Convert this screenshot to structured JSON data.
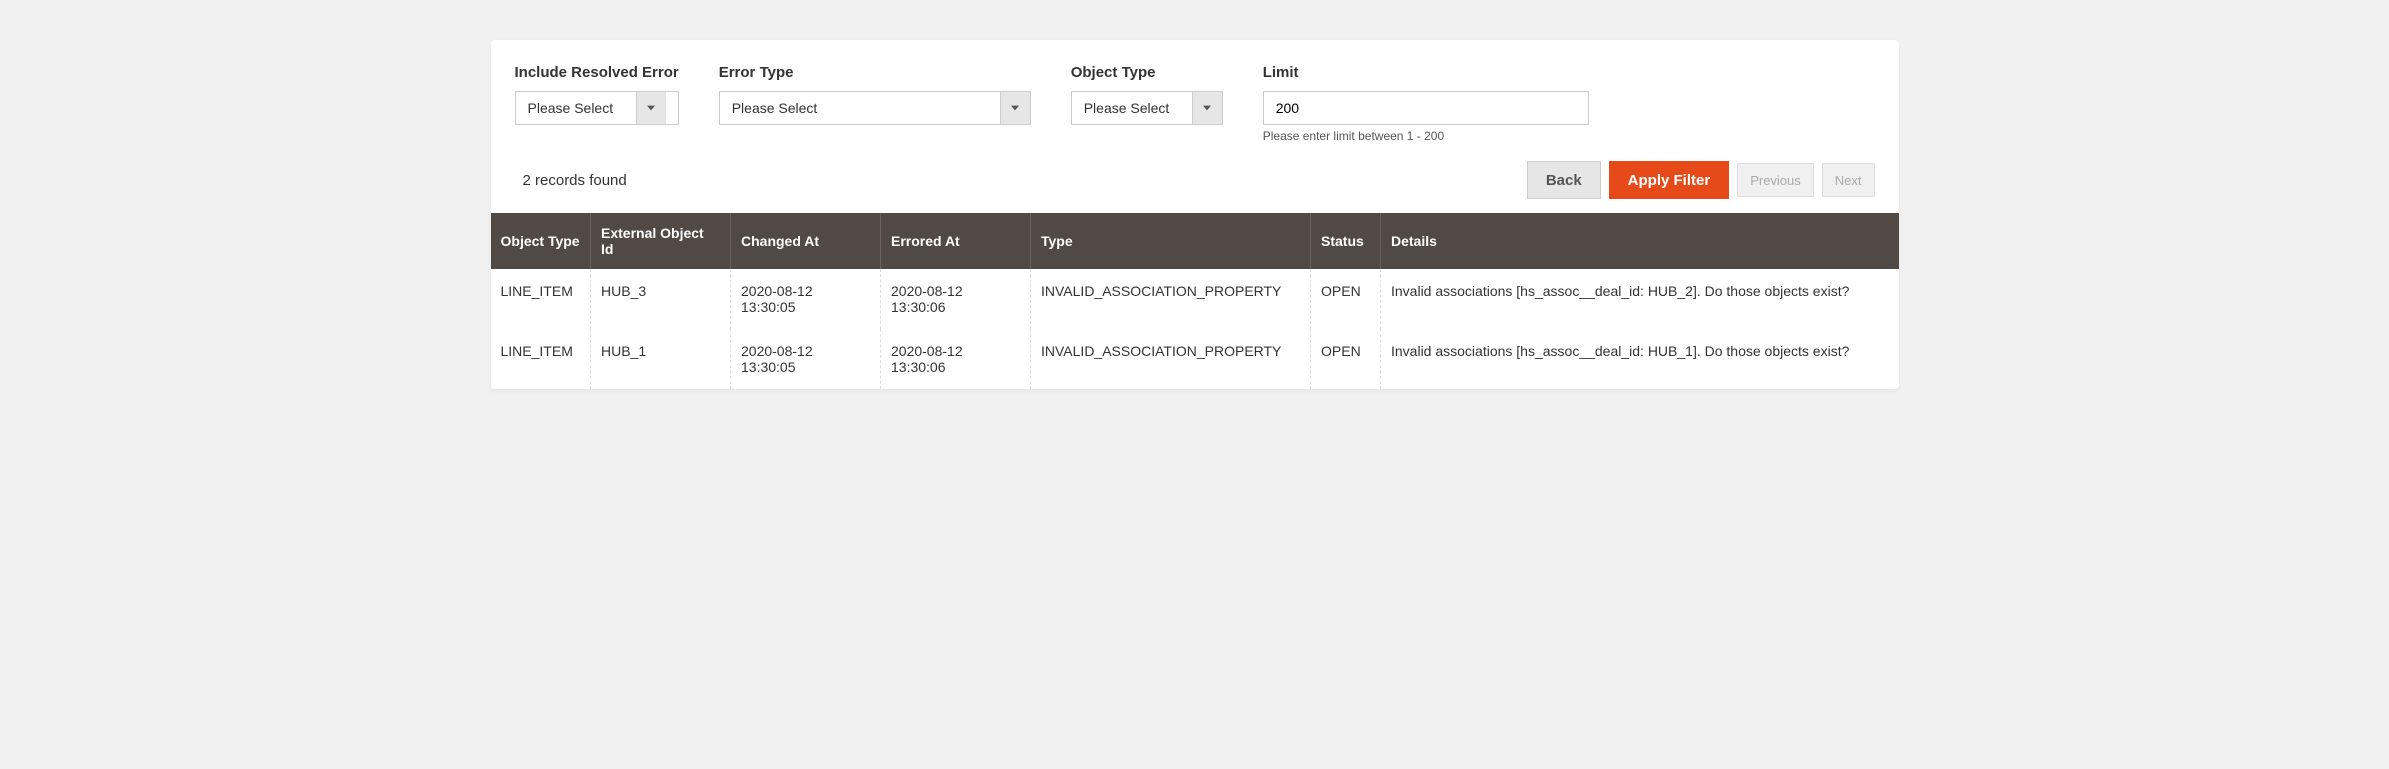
{
  "filters": {
    "include_resolved": {
      "label": "Include Resolved Error",
      "placeholder": "Please Select"
    },
    "error_type": {
      "label": "Error Type",
      "placeholder": "Please Select"
    },
    "object_type": {
      "label": "Object Type",
      "placeholder": "Please Select"
    },
    "limit": {
      "label": "Limit",
      "value": "200",
      "hint": "Please enter limit between 1 - 200"
    }
  },
  "records_found": "2 records found",
  "buttons": {
    "back": "Back",
    "apply": "Apply Filter",
    "previous": "Previous",
    "next": "Next"
  },
  "columns": {
    "object_type": "Object Type",
    "external_object_id": "External Object Id",
    "changed_at": "Changed At",
    "errored_at": "Errored At",
    "type": "Type",
    "status": "Status",
    "details": "Details"
  },
  "rows": [
    {
      "object_type": "LINE_ITEM",
      "external_object_id": "HUB_3",
      "changed_at": "2020-08-12 13:30:05",
      "errored_at": "2020-08-12 13:30:06",
      "type": "INVALID_ASSOCIATION_PROPERTY",
      "status": "OPEN",
      "details": "Invalid associations [hs_assoc__deal_id: HUB_2]. Do those objects exist?"
    },
    {
      "object_type": "LINE_ITEM",
      "external_object_id": "HUB_1",
      "changed_at": "2020-08-12 13:30:05",
      "errored_at": "2020-08-12 13:30:06",
      "type": "INVALID_ASSOCIATION_PROPERTY",
      "status": "OPEN",
      "details": "Invalid associations [hs_assoc__deal_id: HUB_1]. Do those objects exist?"
    }
  ]
}
